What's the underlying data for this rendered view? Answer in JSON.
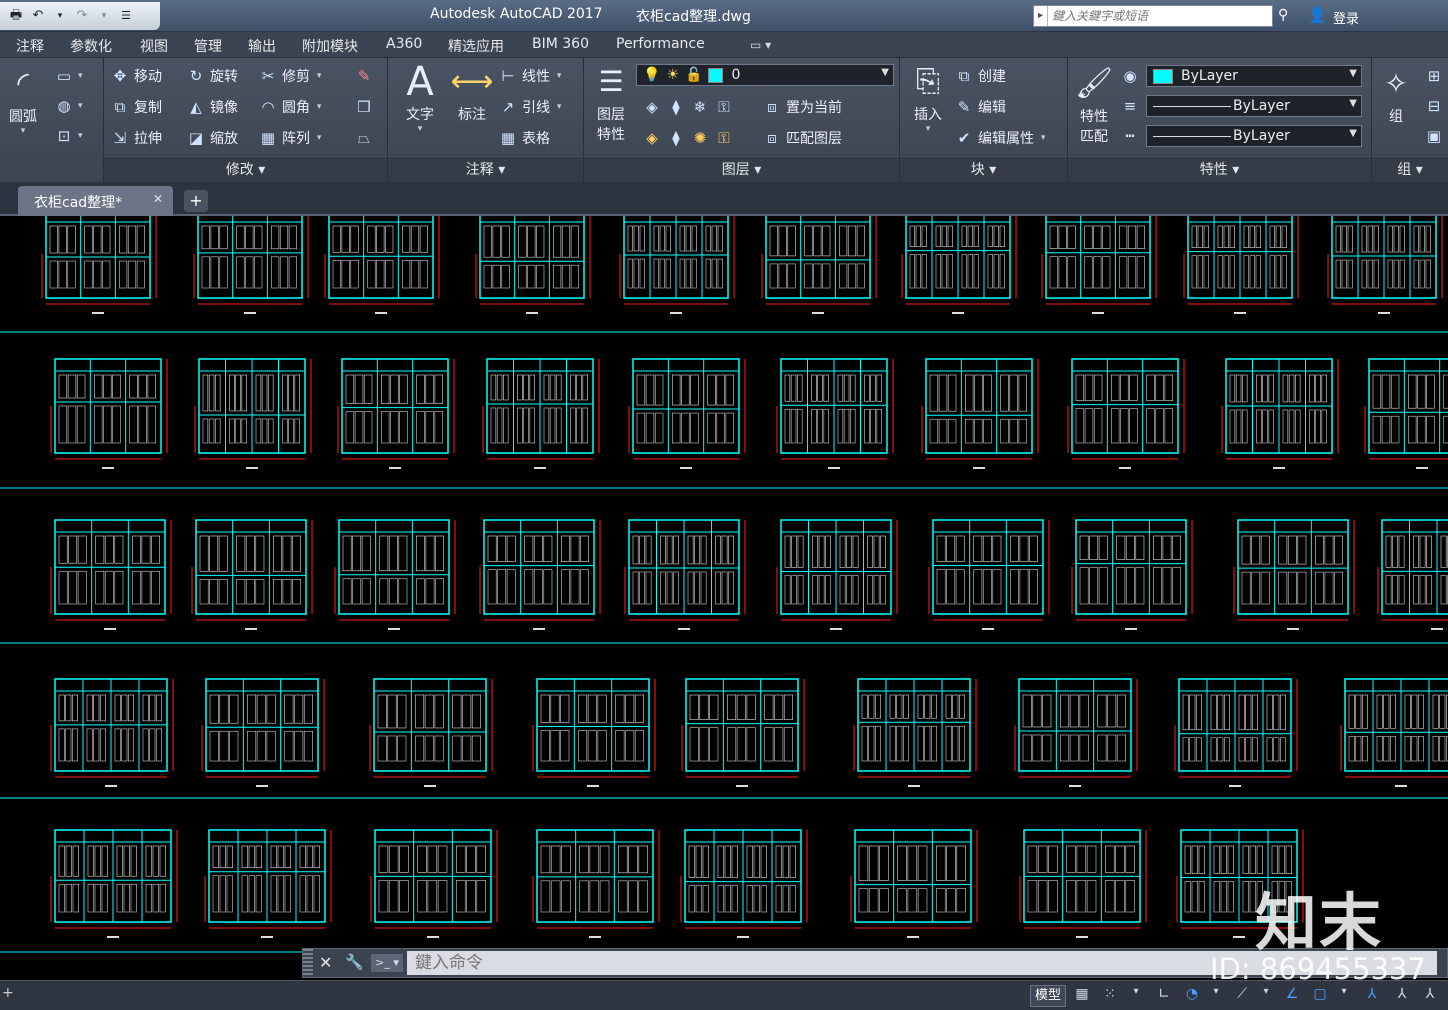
{
  "titlebar": {
    "app_title": "Autodesk AutoCAD 2017",
    "file_name": "衣柜cad整理.dwg",
    "search_placeholder": "鍵入关鍵字或短语",
    "login_label": "登录"
  },
  "ribbon_tabs": [
    "注释",
    "参数化",
    "视图",
    "管理",
    "输出",
    "附加模块",
    "A360",
    "精选应用",
    "BIM 360",
    "Performance"
  ],
  "ribbon": {
    "draw": {
      "arc_label": "圆弧"
    },
    "modify": {
      "footer": "修改",
      "move": "移动",
      "rotate": "旋转",
      "trim": "修剪",
      "copy": "复制",
      "mirror": "镜像",
      "fillet": "圆角",
      "stretch": "拉伸",
      "scale": "缩放",
      "array": "阵列"
    },
    "annotation": {
      "footer": "注释",
      "text": "文字",
      "dimension": "标注",
      "linetype": "线性",
      "leader": "引线",
      "table": "表格"
    },
    "layers": {
      "footer": "图层",
      "layer_properties_1": "图层",
      "layer_properties_2": "特性",
      "current_layer": "0",
      "set_current": "置为当前",
      "match_layer": "匹配图层"
    },
    "block": {
      "footer": "块",
      "insert": "插入",
      "create": "创建",
      "edit": "编辑",
      "edit_attributes": "编辑属性"
    },
    "properties": {
      "footer": "特性",
      "match_1": "特性",
      "match_2": "匹配",
      "color": "ByLayer",
      "lineweight": "ByLayer",
      "linetype": "ByLayer"
    },
    "groups": {
      "footer": "组",
      "group": "组"
    }
  },
  "document_tab": {
    "label": "衣柜cad整理*"
  },
  "command_line": {
    "placeholder": "鍵入命令"
  },
  "status": {
    "model_label": "模型"
  },
  "watermark": {
    "logo": "知末",
    "id": "ID: 869455337"
  },
  "colors": {
    "cad_cyan": "#00ffff",
    "cad_red": "#ff2020",
    "canvas_bg": "#000000"
  }
}
